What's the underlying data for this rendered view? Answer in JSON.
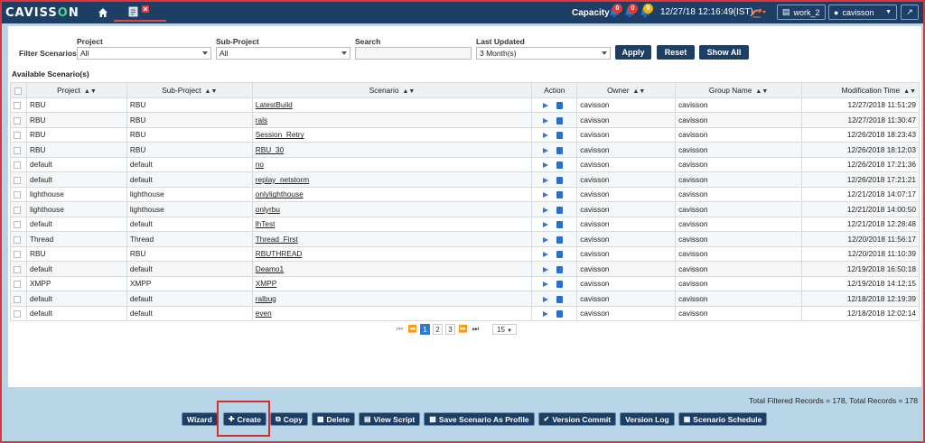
{
  "app": {
    "logo_prefix": "CAVISS",
    "logo_o": "O",
    "logo_suffix": "N"
  },
  "topbar": {
    "capacity_label": "Capacity",
    "bells": [
      {
        "count": "0",
        "color": "#e53935"
      },
      {
        "count": "0",
        "color": "#e53935"
      },
      {
        "count": "0",
        "color": "#f6b400"
      }
    ],
    "datetime": "12/27/18 12:16:49(IST)",
    "workspace": "work_2",
    "user": "cavisson"
  },
  "filters": {
    "label": "Filter Scenarios:",
    "project_label": "Project",
    "project_value": "All",
    "subproject_label": "Sub-Project",
    "subproject_value": "All",
    "search_label": "Search",
    "search_value": "",
    "updated_label": "Last Updated",
    "updated_value": "3 Month(s)",
    "apply": "Apply",
    "reset": "Reset",
    "show_all": "Show All"
  },
  "table": {
    "caption": "Available Scenario(s)",
    "headers": [
      "Project",
      "Sub-Project",
      "Scenario",
      "Action",
      "Owner",
      "Group Name",
      "Modification Time"
    ],
    "rows": [
      [
        "RBU",
        "RBU",
        "LatestBuild",
        "cavisson",
        "cavisson",
        "12/27/2018 11:51:29"
      ],
      [
        "RBU",
        "RBU",
        "rals",
        "cavisson",
        "cavisson",
        "12/27/2018 11:30:47"
      ],
      [
        "RBU",
        "RBU",
        "Session_Retry",
        "cavisson",
        "cavisson",
        "12/26/2018 18:23:43"
      ],
      [
        "RBU",
        "RBU",
        "RBU_30",
        "cavisson",
        "cavisson",
        "12/26/2018 18:12:03"
      ],
      [
        "default",
        "default",
        "no",
        "cavisson",
        "cavisson",
        "12/26/2018 17:21:36"
      ],
      [
        "default",
        "default",
        "replay_netstorm",
        "cavisson",
        "cavisson",
        "12/26/2018 17:21:21"
      ],
      [
        "lighthouse",
        "lighthouse",
        "onlylighthouse",
        "cavisson",
        "cavisson",
        "12/21/2018 14:07:17"
      ],
      [
        "lighthouse",
        "lighthouse",
        "onlyrbu",
        "cavisson",
        "cavisson",
        "12/21/2018 14:00:50"
      ],
      [
        "default",
        "default",
        "lhTest",
        "cavisson",
        "cavisson",
        "12/21/2018 12:28:48"
      ],
      [
        "Thread",
        "Thread",
        "Thread_First",
        "cavisson",
        "cavisson",
        "12/20/2018 11:56:17"
      ],
      [
        "RBU",
        "RBU",
        "RBUTHREAD",
        "cavisson",
        "cavisson",
        "12/20/2018 11:10:39"
      ],
      [
        "default",
        "default",
        "Deamo1",
        "cavisson",
        "cavisson",
        "12/19/2018 16:50:18"
      ],
      [
        "XMPP",
        "XMPP",
        "XMPP",
        "cavisson",
        "cavisson",
        "12/19/2018 14:12:15"
      ],
      [
        "default",
        "default",
        "ralbug",
        "cavisson",
        "cavisson",
        "12/18/2018 12:19:39"
      ],
      [
        "default",
        "default",
        "even",
        "cavisson",
        "cavisson",
        "12/18/2018 12:02:14"
      ]
    ]
  },
  "pager": {
    "pages": [
      "1",
      "2",
      "3"
    ],
    "per_page": "15"
  },
  "totals": "Total Filtered Records = 178, Total Records = 178",
  "actions": [
    "Wizard",
    "Create",
    "Copy",
    "Delete",
    "View Script",
    "Save Scenario As Profile",
    "Version Commit",
    "Version Log",
    "Scenario Schedule"
  ]
}
